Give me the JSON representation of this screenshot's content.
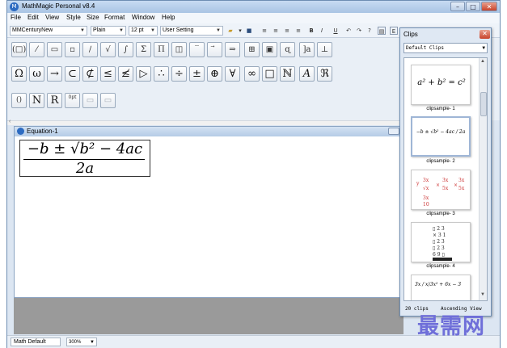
{
  "app_title": "MathMagic Personal v8.4",
  "menu": [
    "File",
    "Edit",
    "View",
    "Style",
    "Size",
    "Format",
    "Window",
    "Help"
  ],
  "format_toolbar": {
    "font": "MMCenturyNew",
    "style": "Plain",
    "size": "12 pt",
    "setting": "User Setting"
  },
  "palette_row2": [
    "Ω",
    "ω",
    "→",
    "⊂",
    "⊄",
    "≤",
    "≰",
    "▷",
    "∴",
    "÷",
    "±",
    "⊕",
    "∀",
    "∞",
    "□",
    "ℕ",
    "A",
    "ℜ"
  ],
  "palette_row3": [
    "()",
    "N",
    "R",
    "0pt",
    "",
    ""
  ],
  "equation_window": {
    "title": "Equation-1",
    "numerator": "−b ± √b² − 4ac",
    "denominator": "2a"
  },
  "status": {
    "mode": "Math Default",
    "zoom": "300%"
  },
  "clips": {
    "title": "Clips",
    "library": "Default Clips",
    "items": [
      {
        "label": "clipsample- 1",
        "preview": "a² + b² = c²"
      },
      {
        "label": "clipsample- 2",
        "preview": "−b ± √b² − 4ac / 2a"
      },
      {
        "label": "clipsample- 3",
        "preview": ""
      },
      {
        "label": "clipsample- 4",
        "preview": ""
      },
      {
        "label": "",
        "preview": "3x / x)3x² + 6x − 3"
      }
    ],
    "count": "20 clips",
    "sort": "Ascending View"
  },
  "watermark": "最需网",
  "colors": {
    "accent": "#2d6bc1",
    "close_red": "#c8432a",
    "watermark": "#6f6fd9"
  }
}
